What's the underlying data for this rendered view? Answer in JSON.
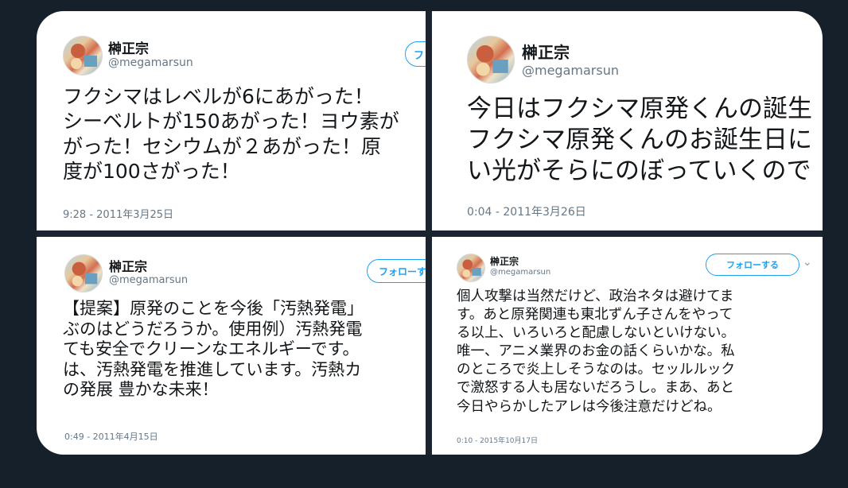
{
  "tweets": [
    {
      "name": "榊正宗",
      "handle": "@megamarsun",
      "follow_label": "フ",
      "text": "フクシマはレベルが6にあがった！\nシーベルトが150あがった！ヨウ素が\nがった！セシウムが２あがった！原\n度が100さがった！",
      "date": "9:28 - 2011年3月25日"
    },
    {
      "name": "榊正宗",
      "handle": "@megamarsun",
      "text": "今日はフクシマ原発くんの誕生\nフクシマ原発くんのお誕生日に\nい光がそらにのぼっていくので",
      "date": "0:04 - 2011年3月26日"
    },
    {
      "name": "榊正宗",
      "handle": "@megamarsun",
      "follow_label": "フォローす",
      "text": "【提案】原発のことを今後「汚熱発電」\nぶのはどうだろうか。使用例）汚熱発電\nても安全でクリーンなエネルギーです。\nは、汚熱発電を推進しています。汚熱カ\nの発展 豊かな未来！",
      "date": "0:49 - 2011年4月15日"
    },
    {
      "name": "榊正宗",
      "handle": "@megamarsun",
      "follow_label": "フォローする",
      "text": "個人攻撃は当然だけど、政治ネタは避けてま\nす。あと原発関連も東北ずん子さんをやって\nる以上、いろいろと配慮しないといけない。\n唯一、アニメ業界のお金の話くらいかな。私\nのところで炎上しそうなのは。セッルルック\nで激怒する人も居ないだろうし。まあ、あと\n今日やらかしたアレは今後注意だけどね。",
      "date": "0:10 - 2015年10月17日"
    }
  ],
  "colors": {
    "accent": "#1da1f2",
    "background": "#15202b"
  }
}
